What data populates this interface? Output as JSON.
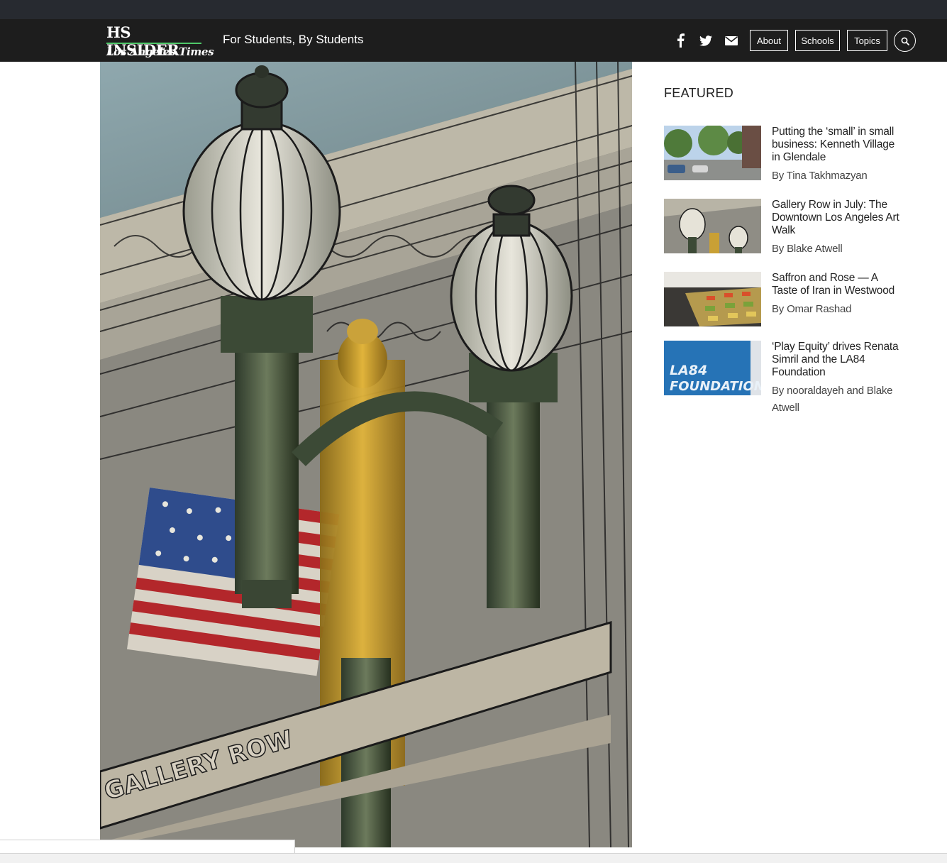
{
  "header": {
    "logo_main": "HS INSIDER",
    "logo_sub": "Los Angeles Times",
    "tagline": "For Students, By Students",
    "social_icons": [
      "facebook-icon",
      "twitter-icon",
      "mail-icon"
    ],
    "nav": {
      "about": "About",
      "schools": "Schools",
      "topics": "Topics"
    },
    "search_icon": "search-icon",
    "accent_color": "#4fc96a",
    "bar_color": "#1d1d1d"
  },
  "hero": {
    "image_lettering": "GALLERY ROW"
  },
  "featured": {
    "heading": "FEATURED",
    "articles": [
      {
        "title": "Putting the ‘small’ in small business: Kenneth Village in Glendale",
        "byline": "By Tina Takhmazyan"
      },
      {
        "title": "Gallery Row in July: The Downtown Los Angeles Art Walk",
        "byline": "By Blake Atwell"
      },
      {
        "title": "Saffron and Rose — A Taste of Iran in Westwood",
        "byline": "By Omar Rashad"
      },
      {
        "title": "‘Play Equity’ drives Renata Simril and the LA84 Foundation",
        "byline": "By nooraldayeh and Blake Atwell",
        "thumb_lettering": "LA84 FOUNDATION"
      }
    ]
  }
}
